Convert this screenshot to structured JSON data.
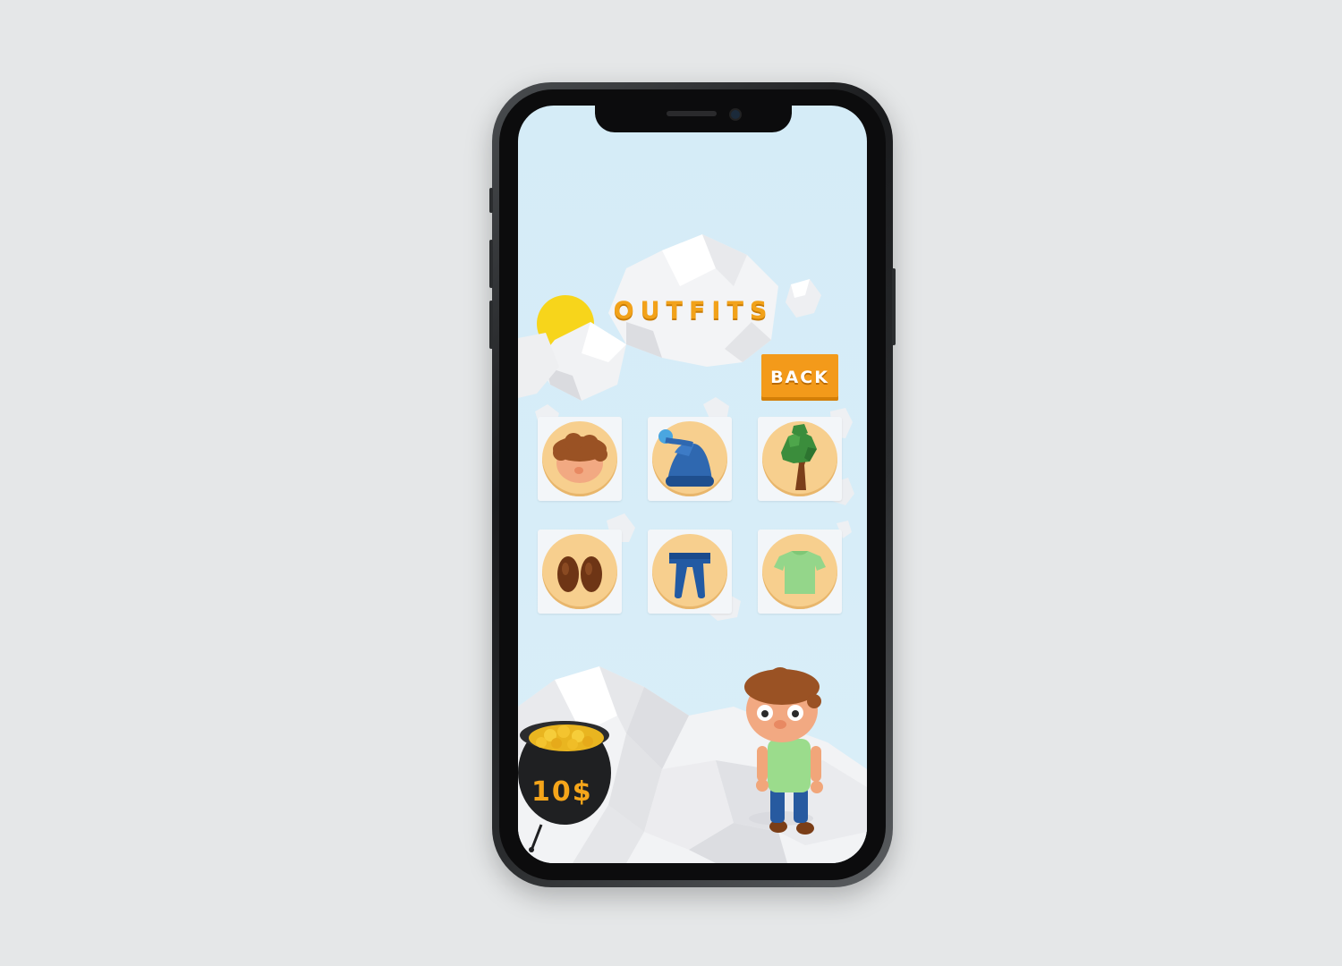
{
  "screen": {
    "title": "OUTFITS",
    "back_label": "BACK",
    "coins": "10$"
  },
  "outfits": [
    {
      "name": "hair",
      "icon": "hair-icon"
    },
    {
      "name": "hat",
      "icon": "beanie-hat-icon"
    },
    {
      "name": "tree",
      "icon": "tree-icon"
    },
    {
      "name": "shoes",
      "icon": "shoes-icon"
    },
    {
      "name": "pants",
      "icon": "pants-icon"
    },
    {
      "name": "shirt",
      "icon": "shirt-icon"
    }
  ],
  "colors": {
    "accent": "#f39a1a",
    "sky": "#d5ecf7",
    "disc": "#f7cf8e",
    "sun": "#f7d51b"
  }
}
